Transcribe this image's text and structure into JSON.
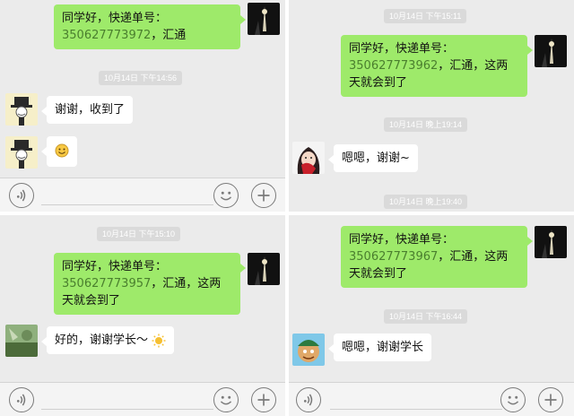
{
  "panel1": {
    "msg_out": {
      "prefix": "同学好，快递单号：",
      "number": "350627773972",
      "suffix": "，汇通"
    },
    "timestamp": "10月14日 下午14:56",
    "reply1": "谢谢，收到了"
  },
  "panel2": {
    "timestamp_top": "10月14日 下午15:11",
    "msg_out": {
      "prefix": "同学好，快递单号：",
      "number": "350627773962",
      "suffix": "，汇通，这两",
      "line3": "天就会到了"
    },
    "timestamp": "10月14日 晚上19:14",
    "reply": "嗯嗯，谢谢~",
    "timestamp_bottom": "10月14日 晚上19:40"
  },
  "panel3": {
    "timestamp": "10月14日 下午15:10",
    "msg_out": {
      "prefix": "同学好，快递单号：",
      "number": "350627773957",
      "suffix": "，汇通，这两",
      "line3": "天就会到了"
    },
    "reply": "好的，谢谢学长～"
  },
  "panel4": {
    "msg_out": {
      "prefix": "同学好，快递单号：",
      "number": "350627773967",
      "suffix": "，汇通，这两",
      "line3": "天就会到了"
    },
    "timestamp": "10月14日 下午16:44",
    "reply": "嗯嗯，谢谢学长"
  },
  "icons": {
    "voice": "voice-icon",
    "emoji": "emoji-icon",
    "plus": "plus-icon"
  },
  "colors": {
    "bubble_out": "#9eea6a",
    "bubble_in": "#ffffff",
    "background": "#ebebeb",
    "tracking_number": "#4a7f2e"
  }
}
